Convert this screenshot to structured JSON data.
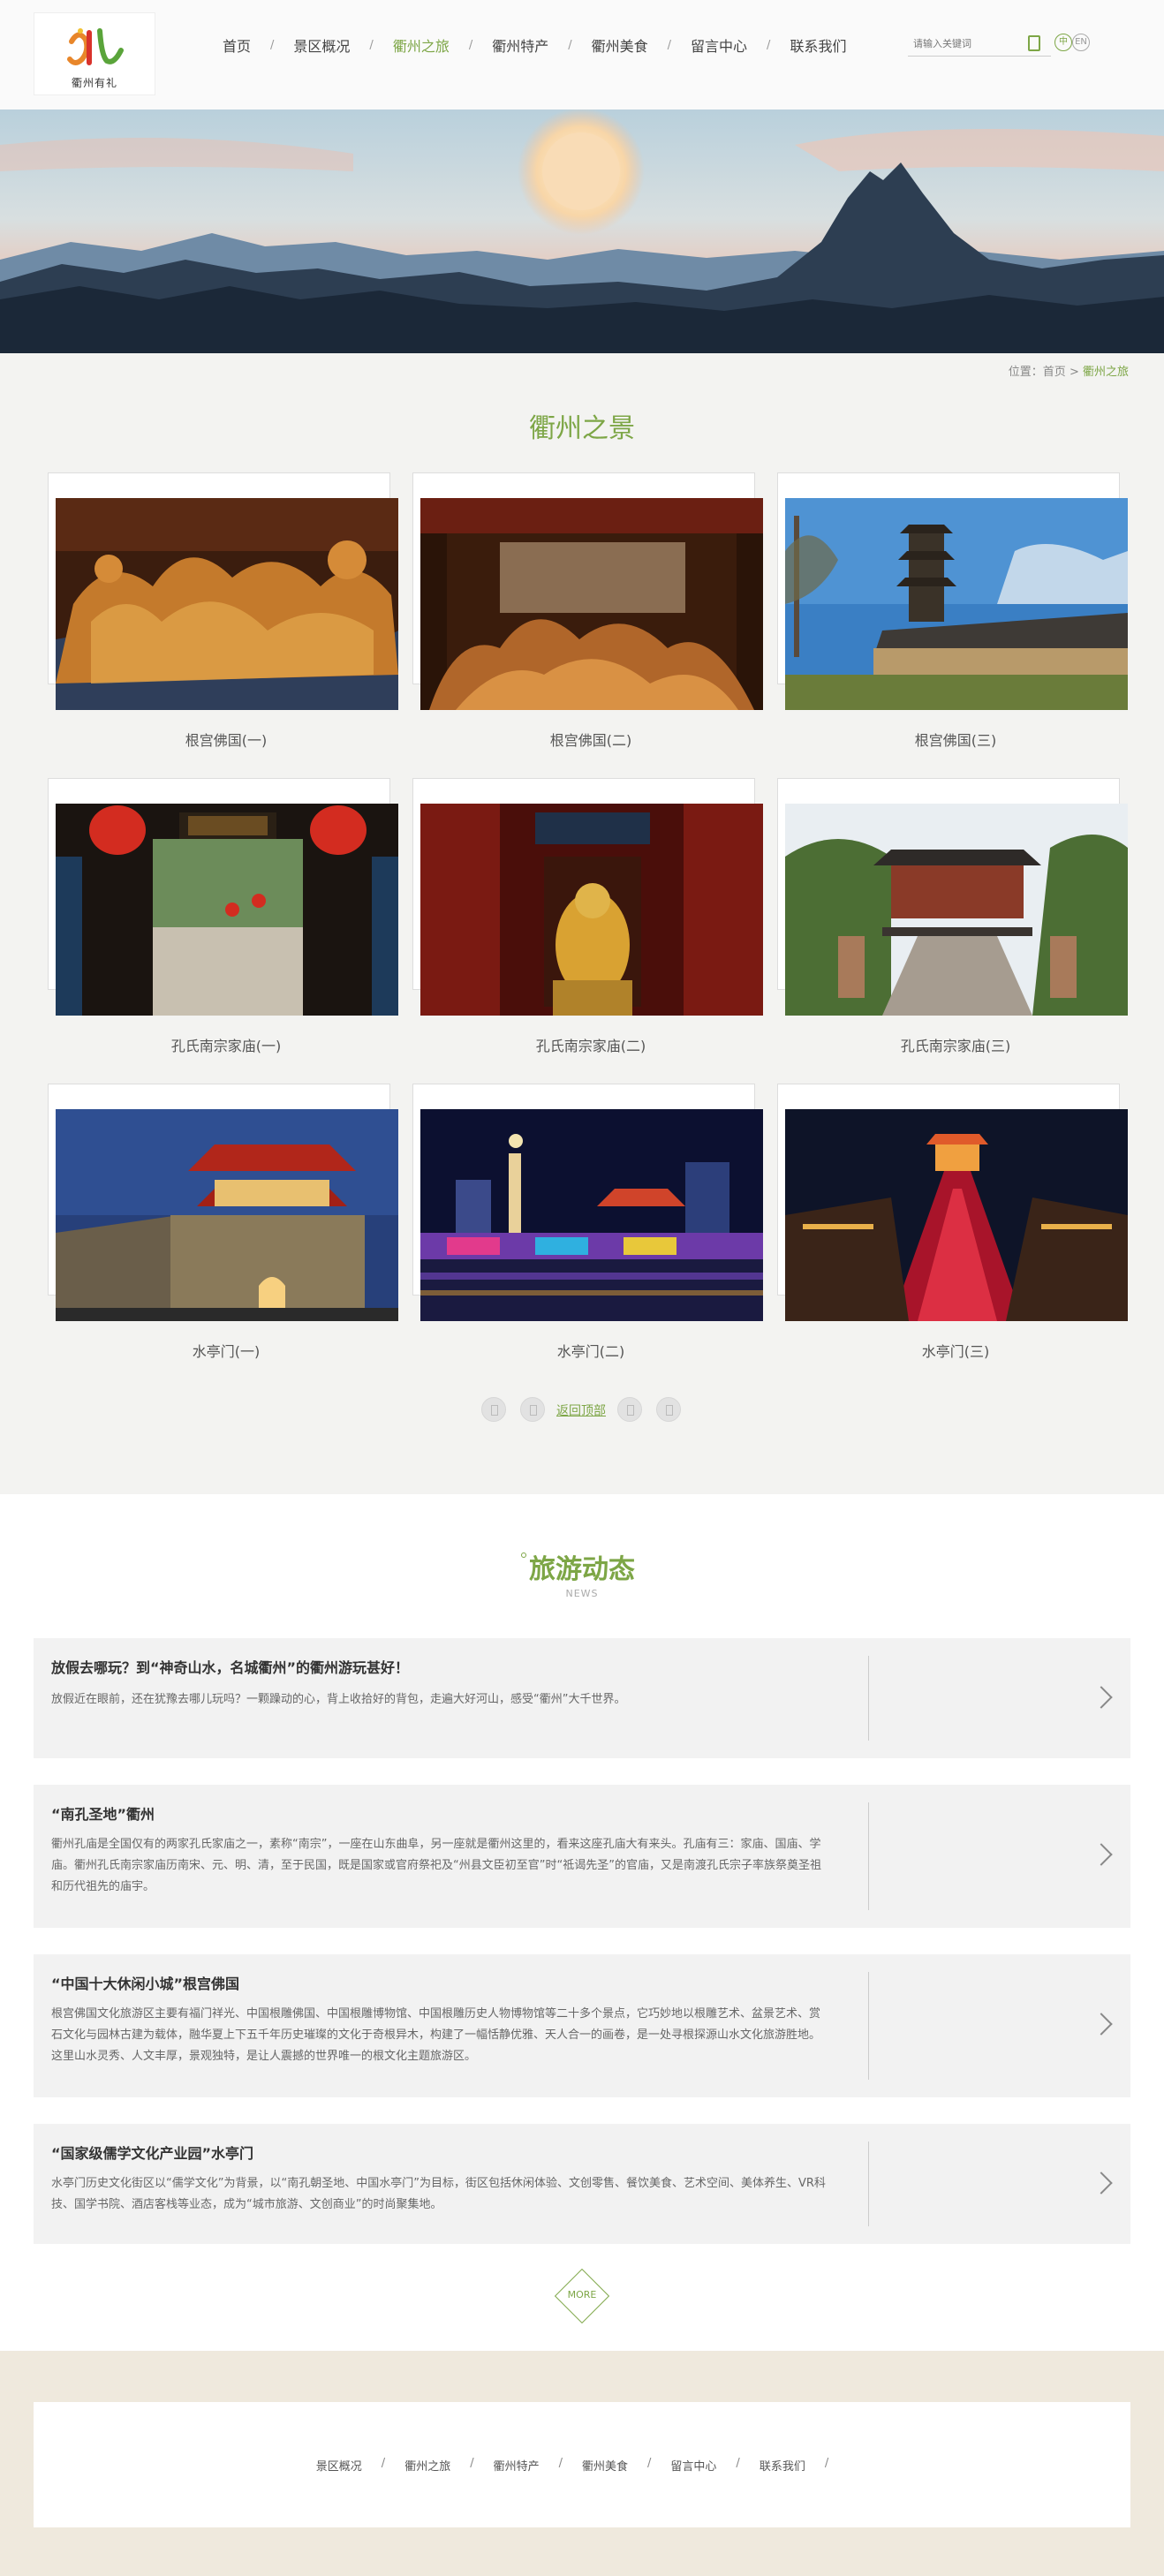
{
  "header": {
    "logo_text": "衢州有礼",
    "nav": [
      "首页",
      "景区概况",
      "衢州之旅",
      "衢州特产",
      "衢州美食",
      "留言中心",
      "联系我们"
    ],
    "active_index": 2,
    "search_placeholder": "请输入关键词",
    "lang_zh": "中",
    "lang_en": "EN"
  },
  "breadcrumb": {
    "prefix": "位置：",
    "home": "首页",
    "sep": ">",
    "current": "衢州之旅"
  },
  "gallery": {
    "title": "衢州之景",
    "items": [
      {
        "caption": "根宫佛国(一)"
      },
      {
        "caption": "根宫佛国(二)"
      },
      {
        "caption": "根宫佛国(三)"
      },
      {
        "caption": "孔氏南宗家庙(一)"
      },
      {
        "caption": "孔氏南宗家庙(二)"
      },
      {
        "caption": "孔氏南宗家庙(三)"
      },
      {
        "caption": "水亭门(一)"
      },
      {
        "caption": "水亭门(二)"
      },
      {
        "caption": "水亭门(三)"
      }
    ]
  },
  "pager": {
    "back_label": "返回顶部"
  },
  "news": {
    "title": "旅游动态",
    "subtitle": "NEWS",
    "items": [
      {
        "title": "放假去哪玩？到“神奇山水，名城衢州”的衢州游玩甚好！",
        "body": "放假近在眼前，还在犹豫去哪儿玩吗？一颗躁动的心，背上收拾好的背包，走遍大好河山，感受“衢州”大千世界。"
      },
      {
        "title": "“南孔圣地”衢州",
        "body": "衢州孔庙是全国仅有的两家孔氏家庙之一，素称“南宗”，一座在山东曲阜，另一座就是衢州这里的，看来这座孔庙大有来头。孔庙有三：家庙、国庙、学庙。衢州孔氏南宗家庙历南宋、元、明、清，至于民国，既是国家或官府祭祀及“州县文臣初至官”时“祗谒先圣”的官庙，又是南渡孔氏宗子率族祭奠圣祖和历代祖先的庙宇。"
      },
      {
        "title": "“中国十大休闲小城”根宫佛国",
        "body": "根宫佛国文化旅游区主要有福门祥光、中国根雕佛国、中国根雕博物馆、中国根雕历史人物博物馆等二十多个景点，它巧妙地以根雕艺术、盆景艺术、赏石文化与园林古建为载体，融华夏上下五千年历史璀璨的文化于奇根异木，构建了一幅恬静优雅、天人合一的画卷，是一处寻根探源山水文化旅游胜地。这里山水灵秀、人文丰厚，景观独特，是让人震撼的世界唯一的根文化主题旅游区。"
      },
      {
        "title": "“国家级儒学文化产业园”水亭门",
        "body": "水亭门历史文化街区以“儒学文化”为背景，以“南孔朝圣地、中国水亭门”为目标，街区包括休闲体验、文创零售、餐饮美食、艺术空间、美体养生、VR科技、国学书院、酒店客栈等业态，成为“城市旅游、文创商业”的时尚聚集地。"
      }
    ],
    "more_label": "MORE"
  },
  "footer": {
    "nav": [
      "景区概况",
      "衢州之旅",
      "衢州特产",
      "衢州美食",
      "留言中心",
      "联系我们"
    ]
  },
  "colors": {
    "accent": "#7da646",
    "page_bg": "#f3f3f1",
    "footer_bg": "#efe9dd"
  }
}
